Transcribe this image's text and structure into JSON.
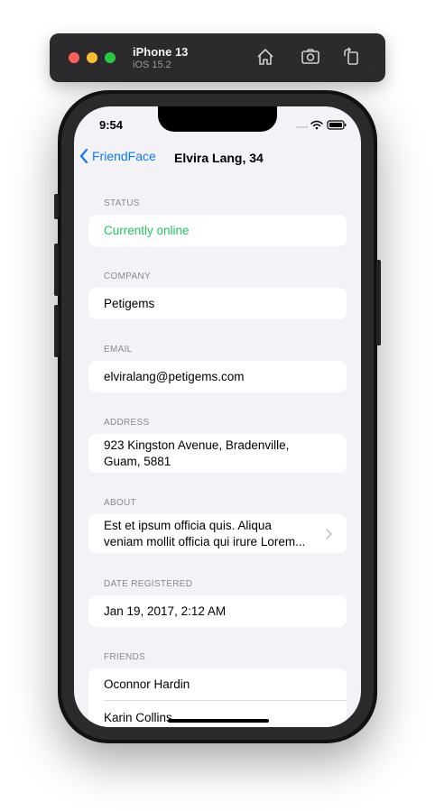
{
  "simulator": {
    "device_name": "iPhone 13",
    "os_version": "iOS 15.2",
    "icons": [
      "home-icon",
      "screenshot-icon",
      "rotate-icon"
    ]
  },
  "status_bar": {
    "time": "9:54"
  },
  "nav": {
    "back_label": "FriendFace",
    "title": "Elvira Lang, 34"
  },
  "sections": {
    "status": {
      "header": "STATUS",
      "value": "Currently online",
      "color": "#22c55e"
    },
    "company": {
      "header": "COMPANY",
      "value": "Petigems"
    },
    "email": {
      "header": "EMAIL",
      "value": "elviralang@petigems.com"
    },
    "address": {
      "header": "ADDRESS",
      "line1": "923 Kingston Avenue, Bradenville,",
      "line2": "Guam, 5881"
    },
    "about": {
      "header": "ABOUT",
      "line1": "Est et ipsum officia quis. Aliqua",
      "line2": "veniam mollit officia qui irure Lorem..."
    },
    "date_registered": {
      "header": "DATE REGISTERED",
      "value": "Jan 19, 2017, 2:12 AM"
    },
    "friends": {
      "header": "FRIENDS",
      "items": [
        "Oconnor Hardin",
        "Karin Collins"
      ]
    }
  },
  "colors": {
    "accent": "#0a7aff",
    "background": "#f2f2f7"
  }
}
